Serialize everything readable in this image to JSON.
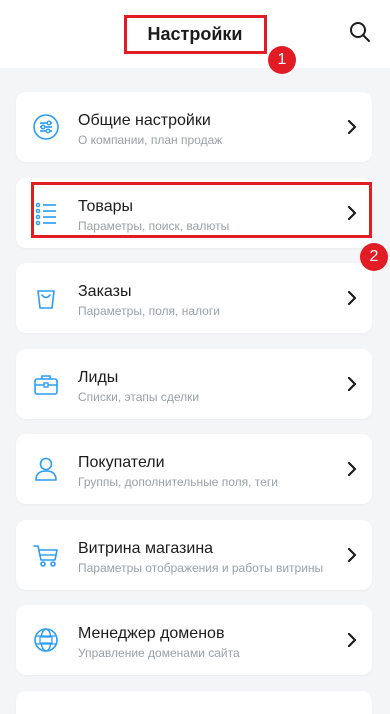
{
  "header": {
    "title": "Настройки"
  },
  "annotations": [
    {
      "number": "1"
    },
    {
      "number": "2"
    }
  ],
  "items": [
    {
      "title": "Общие настройки",
      "subtitle": "О компании, план продаж",
      "icon": "sliders-icon"
    },
    {
      "title": "Товары",
      "subtitle": "Параметры, поиск, валюты",
      "icon": "list-icon"
    },
    {
      "title": "Заказы",
      "subtitle": "Параметры, поля, налоги",
      "icon": "shopping-bag-icon"
    },
    {
      "title": "Лиды",
      "subtitle": "Списки, этапы сделки",
      "icon": "briefcase-icon"
    },
    {
      "title": "Покупатели",
      "subtitle": "Группы, дополнительные поля, теги",
      "icon": "user-icon"
    },
    {
      "title": "Витрина магазина",
      "subtitle": "Параметры отображения и работы витрины",
      "icon": "cart-icon"
    },
    {
      "title": "Менеджер доменов",
      "subtitle": "Управление доменами сайта",
      "icon": "globe-icon"
    }
  ],
  "colors": {
    "accent": "#2a9df4",
    "annotation": "#e21c24"
  }
}
